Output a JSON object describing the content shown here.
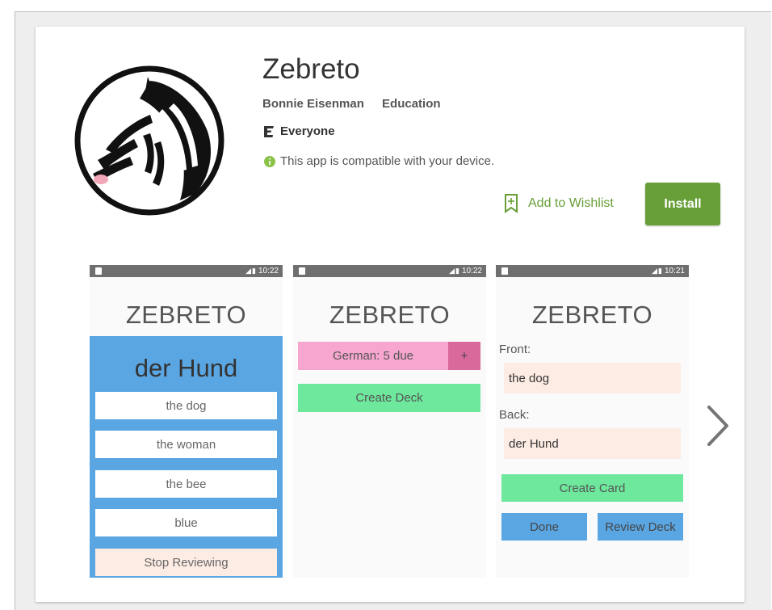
{
  "app": {
    "title": "Zebreto",
    "developer": "Bonnie Eisenman",
    "category": "Education",
    "rating": "Everyone",
    "compatibility": "This app is compatible with your device.",
    "wishlist_label": "Add to Wishlist",
    "install_label": "Install"
  },
  "colors": {
    "accent": "#689f38",
    "review_blue": "#5aa6e3",
    "deck_pink": "#f7a6cf",
    "create_green": "#6ee89c"
  },
  "screenshots": [
    {
      "time": "10:22",
      "header": "ZEBRETO",
      "word": "der Hund",
      "answers": [
        "the dog",
        "the woman",
        "the bee",
        "blue"
      ],
      "stop_label": "Stop Reviewing"
    },
    {
      "time": "10:22",
      "header": "ZEBRETO",
      "deck_label": "German: 5 due",
      "plus_label": "+",
      "create_deck_label": "Create Deck"
    },
    {
      "time": "10:21",
      "header": "ZEBRETO",
      "front_label": "Front:",
      "front_value": "the dog",
      "back_label": "Back:",
      "back_value": "der Hund",
      "create_card_label": "Create Card",
      "done_label": "Done",
      "review_label": "Review Deck"
    }
  ],
  "icons": {
    "logo": "zebra-logo-icon",
    "rating": "esrb-e-icon",
    "info": "info-icon",
    "wishlist": "bookmark-plus-icon",
    "next": "chevron-right-icon"
  }
}
